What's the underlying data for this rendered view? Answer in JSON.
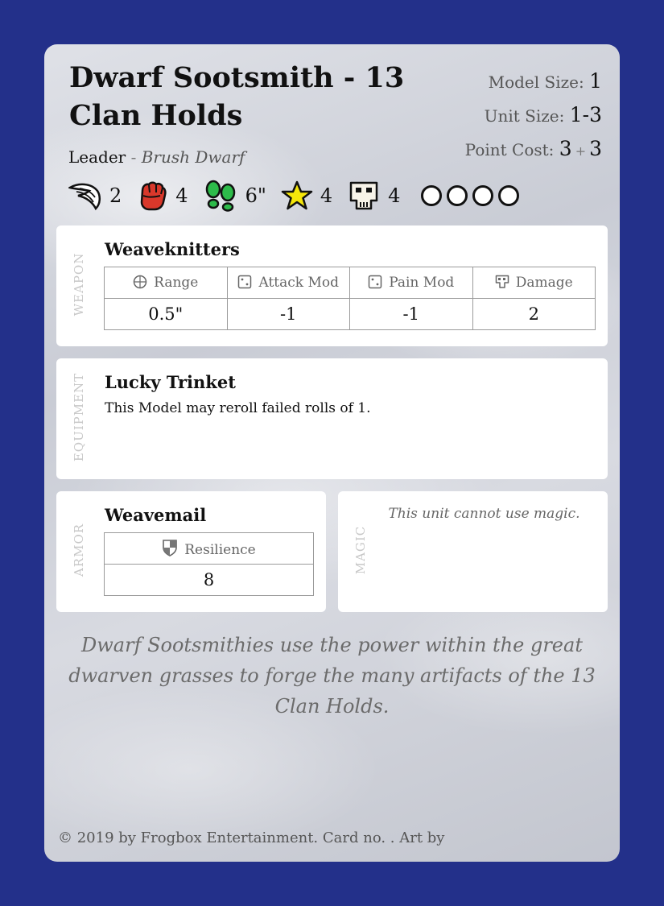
{
  "card": {
    "title": "Dwarf Sootsmith - 13 Clan Holds",
    "role": "Leader",
    "separator": "-",
    "race": "Brush Dwarf",
    "model_size_label": "Model Size:",
    "model_size": "1",
    "unit_size_label": "Unit Size:",
    "unit_size": "1-3",
    "point_cost_label": "Point Cost:",
    "point_cost_base": "3",
    "point_cost_plus": "+",
    "point_cost_extra": "3"
  },
  "stats": [
    {
      "icon": "wing-icon",
      "value": "2"
    },
    {
      "icon": "fist-icon",
      "value": "4"
    },
    {
      "icon": "footprints-icon",
      "value": "6\""
    },
    {
      "icon": "star-icon",
      "value": "4"
    },
    {
      "icon": "skull-icon",
      "value": "4"
    }
  ],
  "wounds": 4,
  "weapon": {
    "side_label": "WEAPON",
    "name": "Weaveknitters",
    "headers": [
      "Range",
      "Attack Mod",
      "Pain Mod",
      "Damage"
    ],
    "header_icons": [
      "crosshair-icon",
      "die-icon",
      "die-icon",
      "damage-icon"
    ],
    "values": [
      "0.5\"",
      "-1",
      "-1",
      "2"
    ]
  },
  "equipment": {
    "side_label": "EQUIPMENT",
    "name": "Lucky Trinket",
    "text": "This Model may reroll failed rolls of 1."
  },
  "armor": {
    "side_label": "ARMOR",
    "name": "Weavemail",
    "header": "Resilience",
    "header_icon": "shield-icon",
    "value": "8"
  },
  "magic": {
    "side_label": "MAGIC",
    "text": "This unit cannot use magic."
  },
  "flavor": "Dwarf Sootsmithies use the power within the great dwarven grasses to forge the many artifacts of the 13 Clan Holds.",
  "footer": "© 2019 by Frogbox Entertainment. Card no. . Art by",
  "colors": {
    "border": "#23308a",
    "fist": "#d9382b",
    "footprints": "#2dbb4a",
    "star": "#f5e60a"
  }
}
